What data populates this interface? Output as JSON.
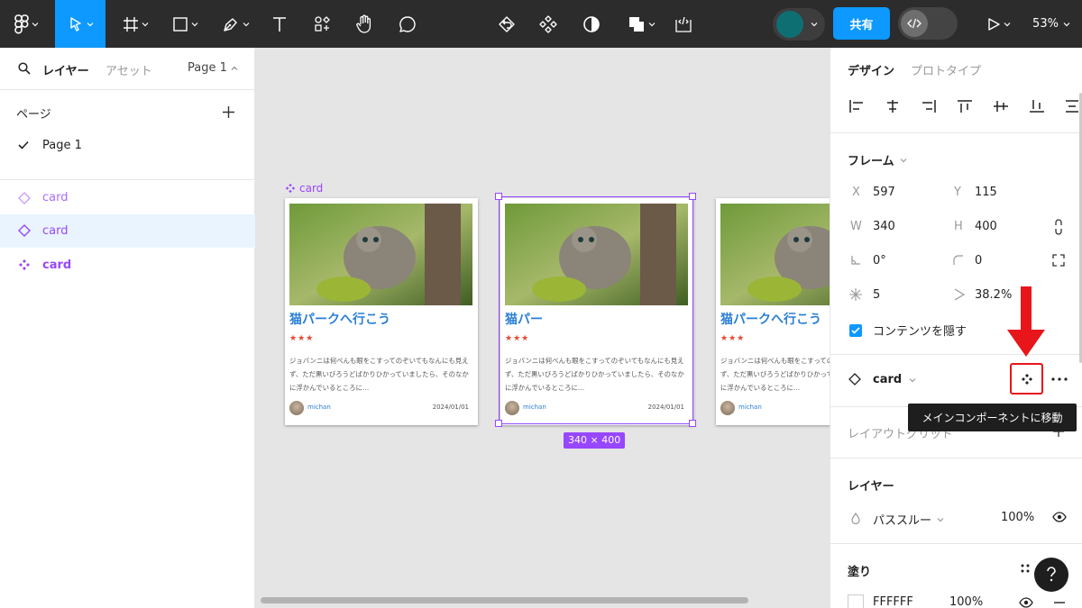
{
  "toolbar": {
    "share_label": "共有",
    "zoom": "53%"
  },
  "left_panel": {
    "tab_layers": "レイヤー",
    "tab_assets": "アセット",
    "page_selector": "Page 1",
    "pages_heading": "ページ",
    "pages": [
      "Page 1"
    ],
    "layers": [
      {
        "name": "card",
        "kind": "instance"
      },
      {
        "name": "card",
        "kind": "instance"
      },
      {
        "name": "card",
        "kind": "component"
      }
    ]
  },
  "canvas": {
    "component_label": "card",
    "size_badge": "340 × 400",
    "card": {
      "title": "猫パークへ行こう",
      "title_short": "猫パー",
      "stars": "★★★",
      "body": "ジョバンニは何べんも眼をこすってのぞいてもなんにも見えず、ただ黒いびろうどばかりひかっていましたら、そのなかに浮かんでいるところに…",
      "author": "michan",
      "date": "2024/01/01"
    }
  },
  "right_panel": {
    "tab_design": "デザイン",
    "tab_prototype": "プロトタイプ",
    "frame_heading": "フレーム",
    "x_label": "X",
    "x": "597",
    "y_label": "Y",
    "y": "115",
    "w_label": "W",
    "w": "340",
    "h_label": "H",
    "h": "400",
    "rotation": "0°",
    "radius": "0",
    "count": "5",
    "ratio": "38.2%",
    "clip_content": "コンテンツを隠す",
    "instance_name": "card",
    "tooltip": "メインコンポーネントに移動",
    "layout_grid_partial": "レイアウトグリッド",
    "layer_heading": "レイヤー",
    "blend_mode": "パススルー",
    "opacity": "100%",
    "fill_heading": "塗り",
    "fill_hex": "FFFFFF",
    "fill_opacity": "100%"
  },
  "colors": {
    "accent": "#0d99ff",
    "selection": "#9747ff",
    "annotation_red": "#e8151b",
    "avatar": "#0e6f73"
  }
}
